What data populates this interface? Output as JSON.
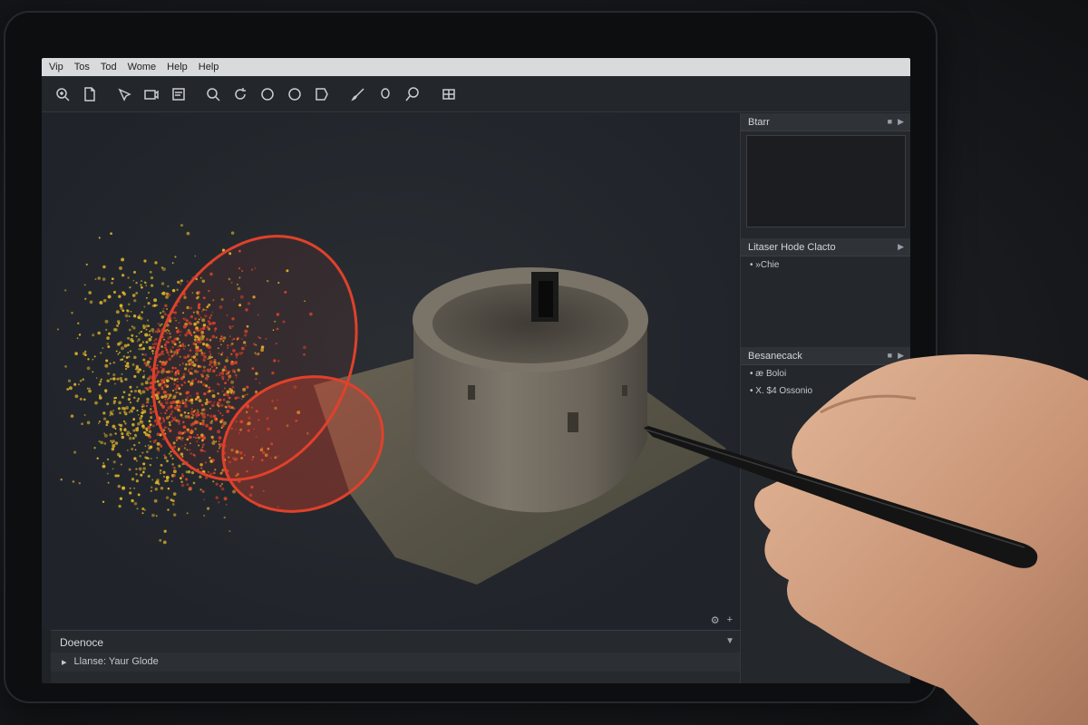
{
  "menu": [
    "Vip",
    "Tos",
    "Tod",
    "Wome",
    "Help",
    "Help"
  ],
  "toolbar": {
    "icons": [
      "zoom-icon",
      "file-icon",
      "select-icon",
      "camera-icon",
      "note-icon",
      "search-icon",
      "rotate-icon",
      "circle-icon",
      "circle-icon",
      "tag-icon",
      "brush-icon",
      "lasso-icon",
      "magnify-icon",
      "grid-icon"
    ]
  },
  "right_panel": {
    "panel1_title": "Btarr",
    "panel2_title": "Litaser Hode Clacto",
    "panel2_items": [
      "• »Chie"
    ],
    "panel3_title": "Besanecack",
    "panel3_items": [
      "• æ Boloi",
      "• X. $4  Ossonio"
    ]
  },
  "console": {
    "title": "Doenoce",
    "line": "Llanse: Yaur Glode"
  },
  "colors": {
    "accent_red": "#e0412b",
    "points_yellow": "#e0b22a",
    "menubar": "#d9dadc",
    "app_bg": "#1f2226"
  }
}
